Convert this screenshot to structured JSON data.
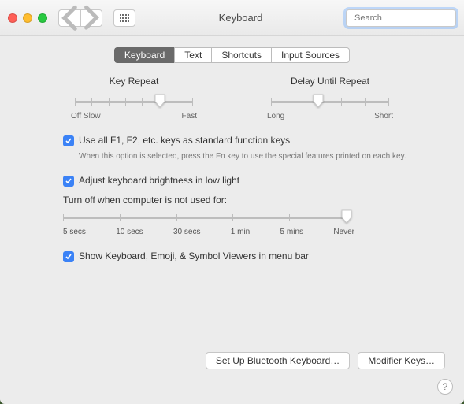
{
  "window": {
    "title": "Keyboard",
    "search_placeholder": "Search"
  },
  "tabs": {
    "keyboard": "Keyboard",
    "text": "Text",
    "shortcuts": "Shortcuts",
    "input_sources": "Input Sources"
  },
  "sliders": {
    "key_repeat": {
      "title": "Key Repeat",
      "left_label": "Off Slow",
      "right_label": "Fast",
      "ticks": 8,
      "value_pct": 72
    },
    "delay_until_repeat": {
      "title": "Delay Until Repeat",
      "left_label": "Long",
      "right_label": "Short",
      "ticks": 6,
      "value_pct": 40
    },
    "backlight_off": {
      "title": "Turn off when computer is not used for:",
      "labels": [
        "5 secs",
        "10 secs",
        "30 secs",
        "1 min",
        "5 mins",
        "Never"
      ],
      "value_pct": 100
    }
  },
  "checkboxes": {
    "fn_keys": {
      "label": "Use all F1, F2, etc. keys as standard function keys",
      "hint": "When this option is selected, press the Fn key to use the special features printed on each key.",
      "checked": true
    },
    "brightness": {
      "label": "Adjust keyboard brightness in low light",
      "checked": true
    },
    "menubar": {
      "label": "Show Keyboard, Emoji, & Symbol Viewers in menu bar",
      "checked": true
    }
  },
  "buttons": {
    "bluetooth": "Set Up Bluetooth Keyboard…",
    "modifier": "Modifier Keys…"
  },
  "help": "?"
}
